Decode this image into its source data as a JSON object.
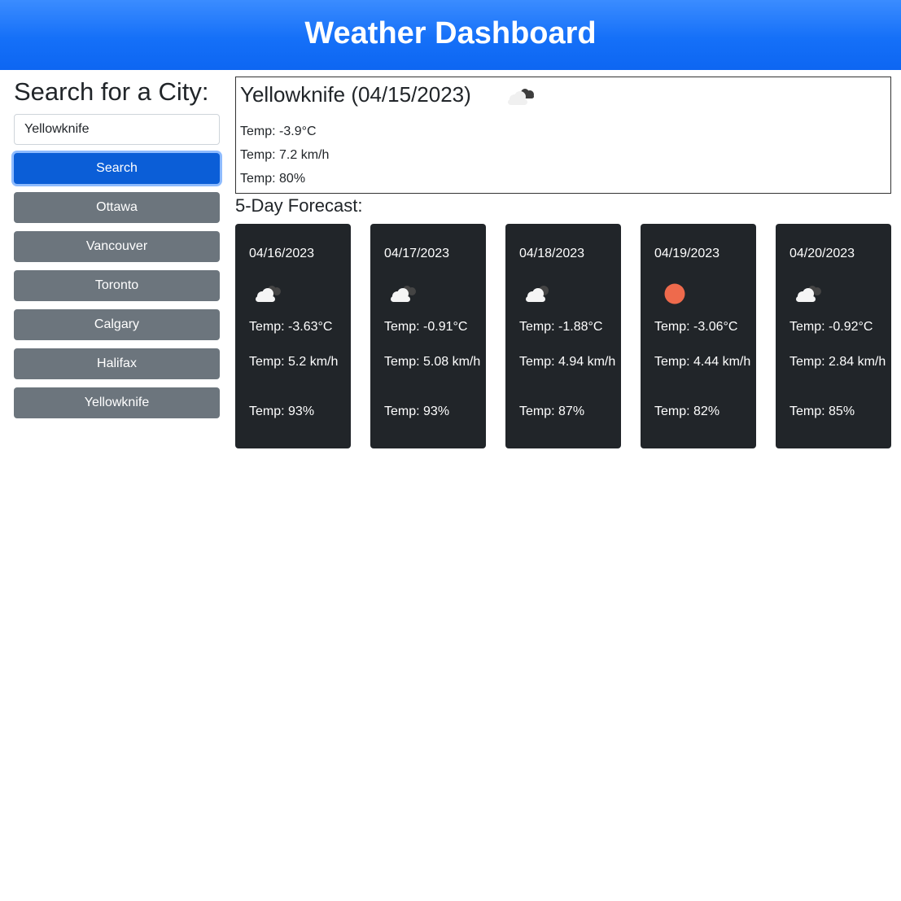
{
  "header": {
    "title": "Weather Dashboard"
  },
  "sidebar": {
    "heading": "Search for a City:",
    "search_value": "Yellowknife",
    "search_button": "Search",
    "history": [
      "Ottawa",
      "Vancouver",
      "Toronto",
      "Calgary",
      "Halifax",
      "Yellowknife"
    ]
  },
  "current": {
    "title": "Yellowknife (04/15/2023)",
    "icon": "cloudy-icon",
    "temp": "Temp: -3.9°C",
    "wind": "Temp: 7.2 km/h",
    "humidity": "Temp: 80%"
  },
  "forecast": {
    "heading": "5-Day Forecast:",
    "days": [
      {
        "date": "04/16/2023",
        "icon": "cloud-icon",
        "temp": "Temp: -3.63°C",
        "wind": "Temp: 5.2 km/h",
        "humidity": "Temp: 93%"
      },
      {
        "date": "04/17/2023",
        "icon": "cloud-icon",
        "temp": "Temp: -0.91°C",
        "wind": "Temp: 5.08 km/h",
        "humidity": "Temp: 93%"
      },
      {
        "date": "04/18/2023",
        "icon": "cloud-icon",
        "temp": "Temp: -1.88°C",
        "wind": "Temp: 4.94 km/h",
        "humidity": "Temp: 87%"
      },
      {
        "date": "04/19/2023",
        "icon": "sun-icon",
        "temp": "Temp: -3.06°C",
        "wind": "Temp: 4.44 km/h",
        "humidity": "Temp: 82%"
      },
      {
        "date": "04/20/2023",
        "icon": "cloud-icon",
        "temp": "Temp: -0.92°C",
        "wind": "Temp: 2.84 km/h",
        "humidity": "Temp: 85%"
      }
    ]
  },
  "colors": {
    "header_blue": "#0d6efd",
    "primary_button": "#0b5ed7",
    "secondary_button": "#6c757d",
    "card_background": "#212529",
    "sun": "#ee6a4c"
  }
}
